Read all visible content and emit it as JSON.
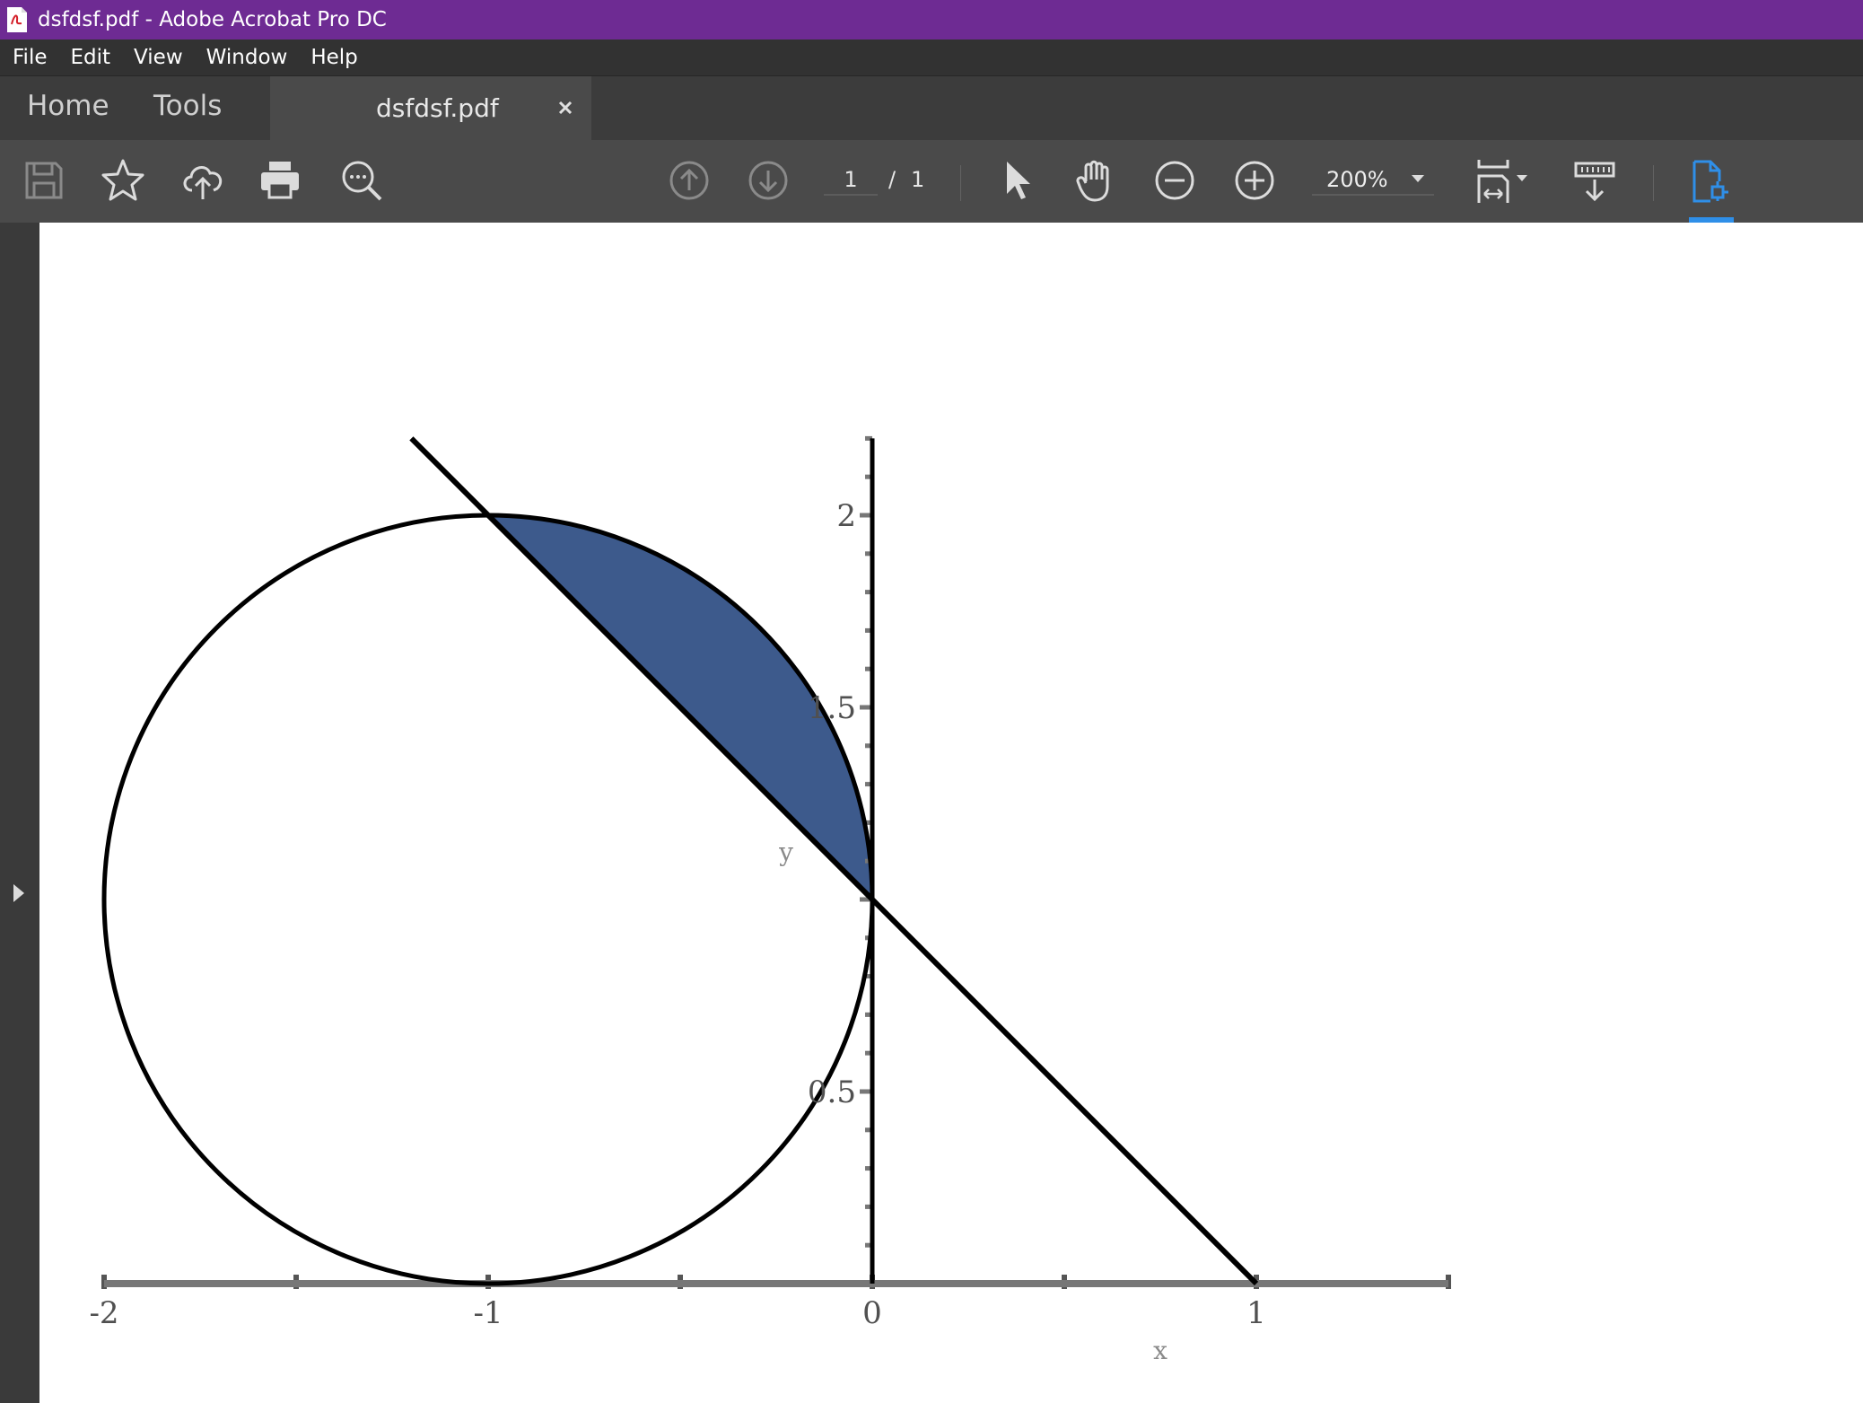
{
  "window": {
    "title": "dsfdsf.pdf - Adobe Acrobat Pro DC"
  },
  "menu": [
    "File",
    "Edit",
    "View",
    "Window",
    "Help"
  ],
  "tabs": {
    "home": "Home",
    "tools": "Tools",
    "document": "dsfdsf.pdf"
  },
  "toolbar": {
    "page_current": "1",
    "page_separator": "/",
    "page_total": "1",
    "zoom": "200%",
    "icons": [
      "save-icon",
      "bookmark-star-icon",
      "upload-cloud-icon",
      "print-icon",
      "find-icon",
      "prev-page-icon",
      "next-page-icon",
      "select-cursor-icon",
      "hand-icon",
      "zoom-out-icon",
      "zoom-in-icon",
      "fit-page-icon",
      "scroll-mode-icon",
      "document-tool-icon"
    ],
    "active_color": "#2f8fe8"
  },
  "chart_data": {
    "type": "line",
    "title": "",
    "xlabel": "x",
    "ylabel": "y",
    "xlim": [
      -2,
      1.5
    ],
    "ylim": [
      0,
      2.2
    ],
    "x_ticks": [
      -2,
      -1.5,
      -1,
      -0.5,
      0,
      0.5,
      1,
      1.5
    ],
    "x_tick_labels": [
      {
        "x": -2,
        "label": "-2"
      },
      {
        "x": -1,
        "label": "-1"
      },
      {
        "x": 0,
        "label": "0"
      },
      {
        "x": 1,
        "label": "1"
      }
    ],
    "y_tick_labels": [
      {
        "y": 0.5,
        "label": "0.5"
      },
      {
        "y": 1.5,
        "label": "1.5"
      },
      {
        "y": 2,
        "label": "2"
      }
    ],
    "series": [
      {
        "kind": "circle",
        "center": [
          -1,
          1
        ],
        "radius": 1,
        "color": "#000000"
      },
      {
        "kind": "line",
        "equation": "y = 1 - x",
        "x_range": [
          -1.2,
          1
        ],
        "color": "#000000"
      }
    ],
    "shaded_region": {
      "description_bounds": "between circle arc and line from (-1,2) to (0,1)",
      "color": "#3d5a8c"
    }
  }
}
